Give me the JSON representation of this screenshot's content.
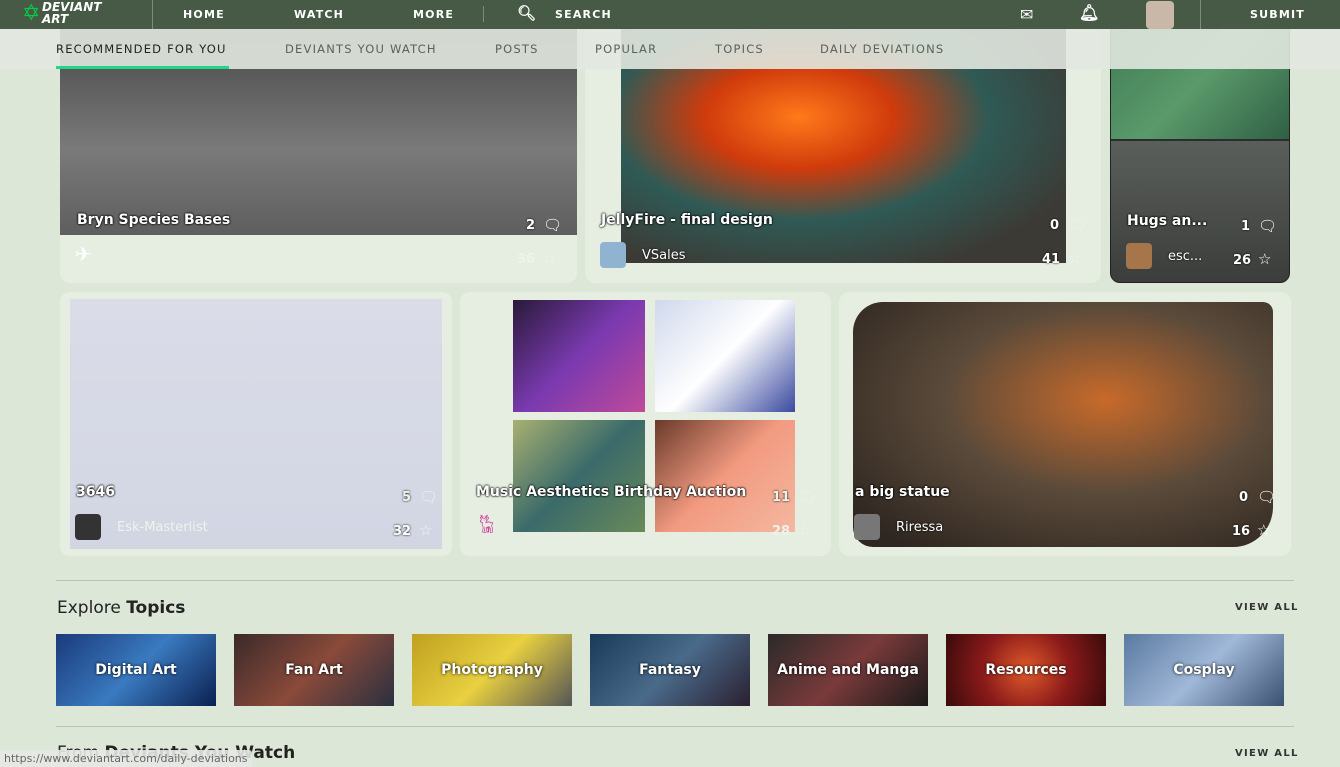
{
  "topbar": {
    "logo": "DEVIANT ART",
    "home": "HOME",
    "watch": "WATCH",
    "more": "MORE",
    "search": "SEARCH",
    "submit": "SUBMIT"
  },
  "subnav": [
    "RECOMMENDED FOR YOU",
    "DEVIANTS YOU WATCH",
    "POSTS",
    "POPULAR",
    "TOPICS",
    "DAILY DEVIATIONS"
  ],
  "cards": [
    {
      "title": "Bryn Species Bases",
      "comments": "2",
      "favs": "36",
      "user": ""
    },
    {
      "title": "JellyFire - final design",
      "comments": "0",
      "favs": "41",
      "user": "VSales"
    },
    {
      "title": "Hugs an...",
      "comments": "1",
      "favs": "26",
      "user": "esc..."
    },
    {
      "title": "3646",
      "comments": "5",
      "favs": "32",
      "user": "Esk-Masterlist"
    },
    {
      "title": "Music Aesthetics Birthday Auction",
      "comments": "11",
      "favs": "28",
      "user": ""
    },
    {
      "title": "a big statue",
      "comments": "0",
      "favs": "16",
      "user": "Riressa"
    }
  ],
  "explore": {
    "prefix": "Explore ",
    "bold": "Topics",
    "view_all": "VIEW ALL",
    "topics": [
      "Digital Art",
      "Fan Art",
      "Photography",
      "Fantasy",
      "Anime and Manga",
      "Resources",
      "Cosplay"
    ]
  },
  "watch_section": {
    "prefix": "From ",
    "bold": "Deviants You Watch",
    "view_all": "VIEW ALL"
  },
  "status_url": "https://www.deviantart.com/daily-deviations"
}
